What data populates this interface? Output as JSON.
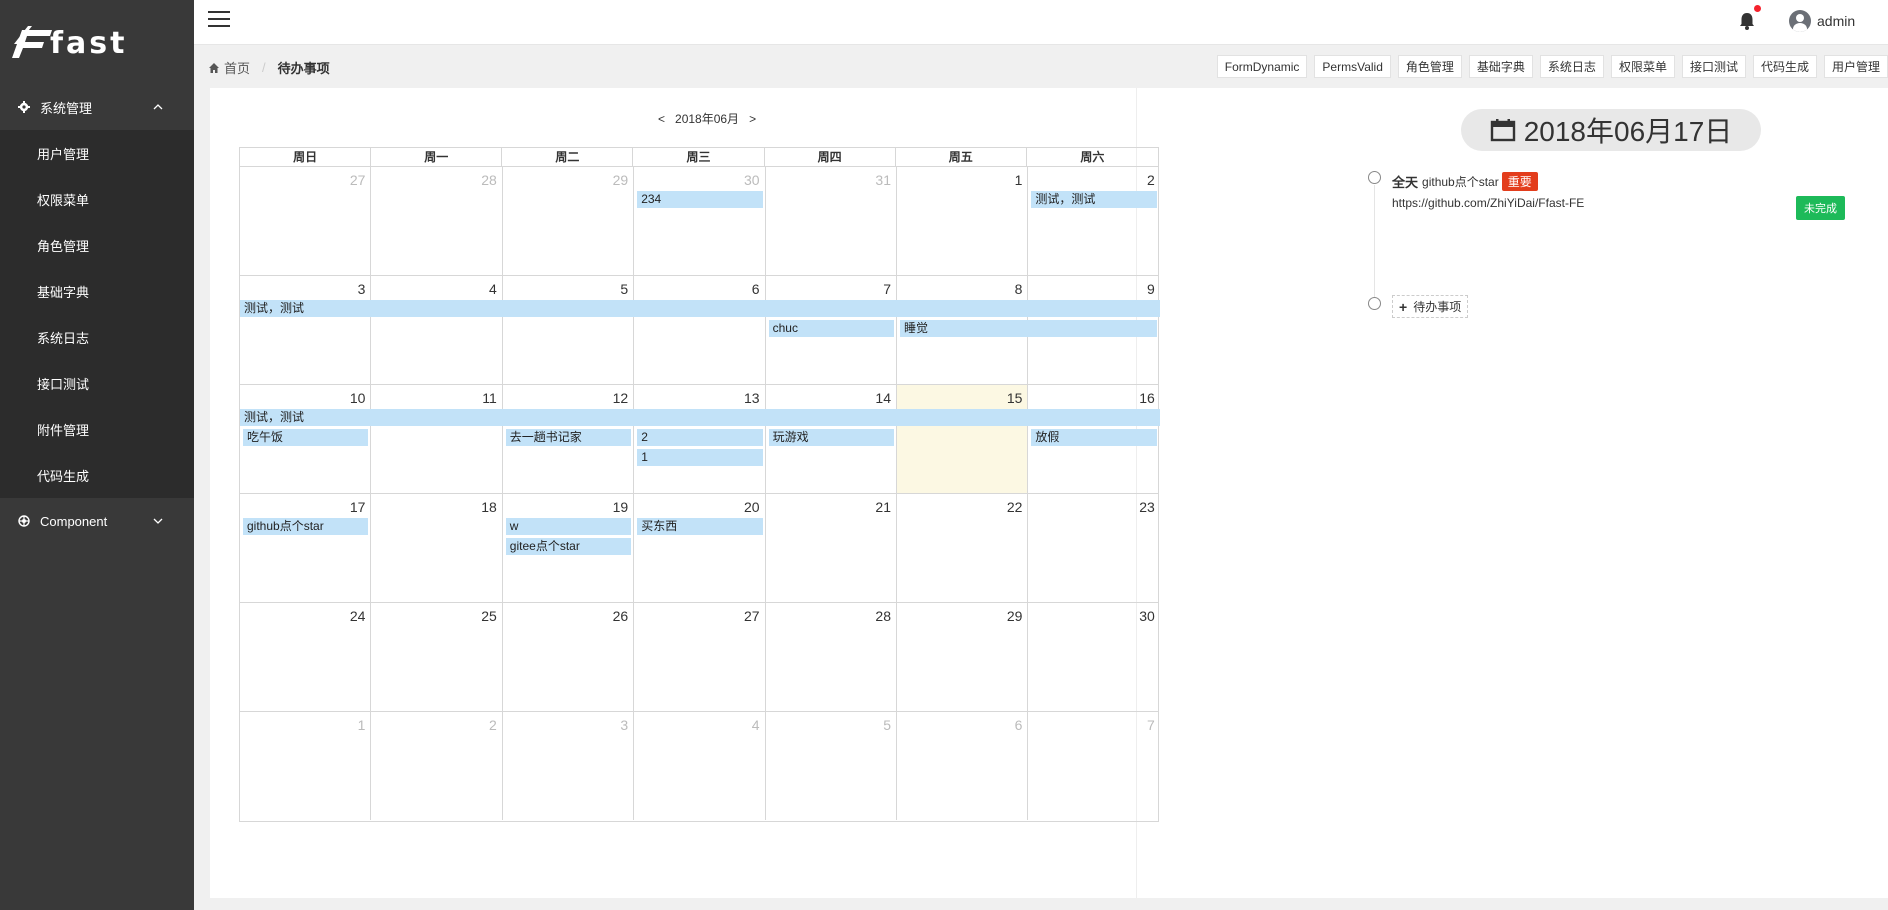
{
  "app": {
    "logo_text": "fast"
  },
  "sidebar": {
    "group_system": "系统管理",
    "items": [
      {
        "label": "用户管理"
      },
      {
        "label": "权限菜单"
      },
      {
        "label": "角色管理"
      },
      {
        "label": "基础字典"
      },
      {
        "label": "系统日志"
      },
      {
        "label": "接口测试"
      },
      {
        "label": "附件管理"
      },
      {
        "label": "代码生成"
      }
    ],
    "group_component": "Component"
  },
  "header": {
    "username": "admin",
    "has_notification": true
  },
  "breadcrumb": {
    "home": "首页",
    "current": "待办事项"
  },
  "quick_tabs": [
    "FormDynamic",
    "PermsValid",
    "角色管理",
    "基础字典",
    "系统日志",
    "权限菜单",
    "接口测试",
    "代码生成",
    "用户管理"
  ],
  "calendar": {
    "title": "2018年06月",
    "prev": "<",
    "next": ">",
    "weekdays": [
      "周日",
      "周一",
      "周二",
      "周三",
      "周四",
      "周五",
      "周六"
    ],
    "weeks": [
      [
        {
          "d": "27",
          "other": true
        },
        {
          "d": "28",
          "other": true
        },
        {
          "d": "29",
          "other": true
        },
        {
          "d": "30",
          "other": true
        },
        {
          "d": "31",
          "other": true
        },
        {
          "d": "1"
        },
        {
          "d": "2"
        }
      ],
      [
        {
          "d": "3"
        },
        {
          "d": "4"
        },
        {
          "d": "5"
        },
        {
          "d": "6"
        },
        {
          "d": "7"
        },
        {
          "d": "8"
        },
        {
          "d": "9"
        }
      ],
      [
        {
          "d": "10"
        },
        {
          "d": "11"
        },
        {
          "d": "12"
        },
        {
          "d": "13"
        },
        {
          "d": "14"
        },
        {
          "d": "15",
          "today": true
        },
        {
          "d": "16"
        }
      ],
      [
        {
          "d": "17"
        },
        {
          "d": "18"
        },
        {
          "d": "19"
        },
        {
          "d": "20"
        },
        {
          "d": "21"
        },
        {
          "d": "22"
        },
        {
          "d": "23"
        }
      ],
      [
        {
          "d": "24"
        },
        {
          "d": "25"
        },
        {
          "d": "26"
        },
        {
          "d": "27"
        },
        {
          "d": "28"
        },
        {
          "d": "29"
        },
        {
          "d": "30"
        }
      ],
      [
        {
          "d": "1",
          "other": true
        },
        {
          "d": "2",
          "other": true
        },
        {
          "d": "3",
          "other": true
        },
        {
          "d": "4",
          "other": true
        },
        {
          "d": "5",
          "other": true
        },
        {
          "d": "6",
          "other": true
        },
        {
          "d": "7",
          "other": true
        }
      ]
    ],
    "events": [
      {
        "title": "234",
        "week": 0,
        "start": 3,
        "span": 1,
        "lane": 0
      },
      {
        "title": "测试，测试",
        "week": 0,
        "start": 6,
        "span": 1,
        "lane": 0
      },
      {
        "title": "测试，测试",
        "week": 1,
        "start": 0,
        "span": 7,
        "lane": 0
      },
      {
        "title": "chuc",
        "week": 1,
        "start": 4,
        "span": 1,
        "lane": 1
      },
      {
        "title": "睡觉",
        "week": 1,
        "start": 5,
        "span": 2,
        "lane": 1
      },
      {
        "title": "测试，测试",
        "week": 2,
        "start": 0,
        "span": 7,
        "lane": 0
      },
      {
        "title": "吃午饭",
        "week": 2,
        "start": 0,
        "span": 1,
        "lane": 1
      },
      {
        "title": "去一趟书记家",
        "week": 2,
        "start": 2,
        "span": 1,
        "lane": 1
      },
      {
        "title": "2",
        "week": 2,
        "start": 3,
        "span": 1,
        "lane": 1
      },
      {
        "title": "1",
        "week": 2,
        "start": 3,
        "span": 1,
        "lane": 2
      },
      {
        "title": "玩游戏",
        "week": 2,
        "start": 4,
        "span": 1,
        "lane": 1
      },
      {
        "title": "放假",
        "week": 2,
        "start": 6,
        "span": 1,
        "lane": 1
      },
      {
        "title": "github点个star",
        "week": 3,
        "start": 0,
        "span": 1,
        "lane": 0
      },
      {
        "title": "w",
        "week": 3,
        "start": 2,
        "span": 1,
        "lane": 0
      },
      {
        "title": "gitee点个star",
        "week": 3,
        "start": 2,
        "span": 1,
        "lane": 1
      },
      {
        "title": "买东西",
        "week": 3,
        "start": 3,
        "span": 1,
        "lane": 0
      }
    ]
  },
  "detail": {
    "date": "2018年06月17日",
    "todo": {
      "allday": "全天",
      "title": "github点个star",
      "tag": "重要",
      "url": "https://github.com/ZhiYiDai/Ffast-FE",
      "status": "未完成"
    },
    "add_label": "待办事项"
  }
}
